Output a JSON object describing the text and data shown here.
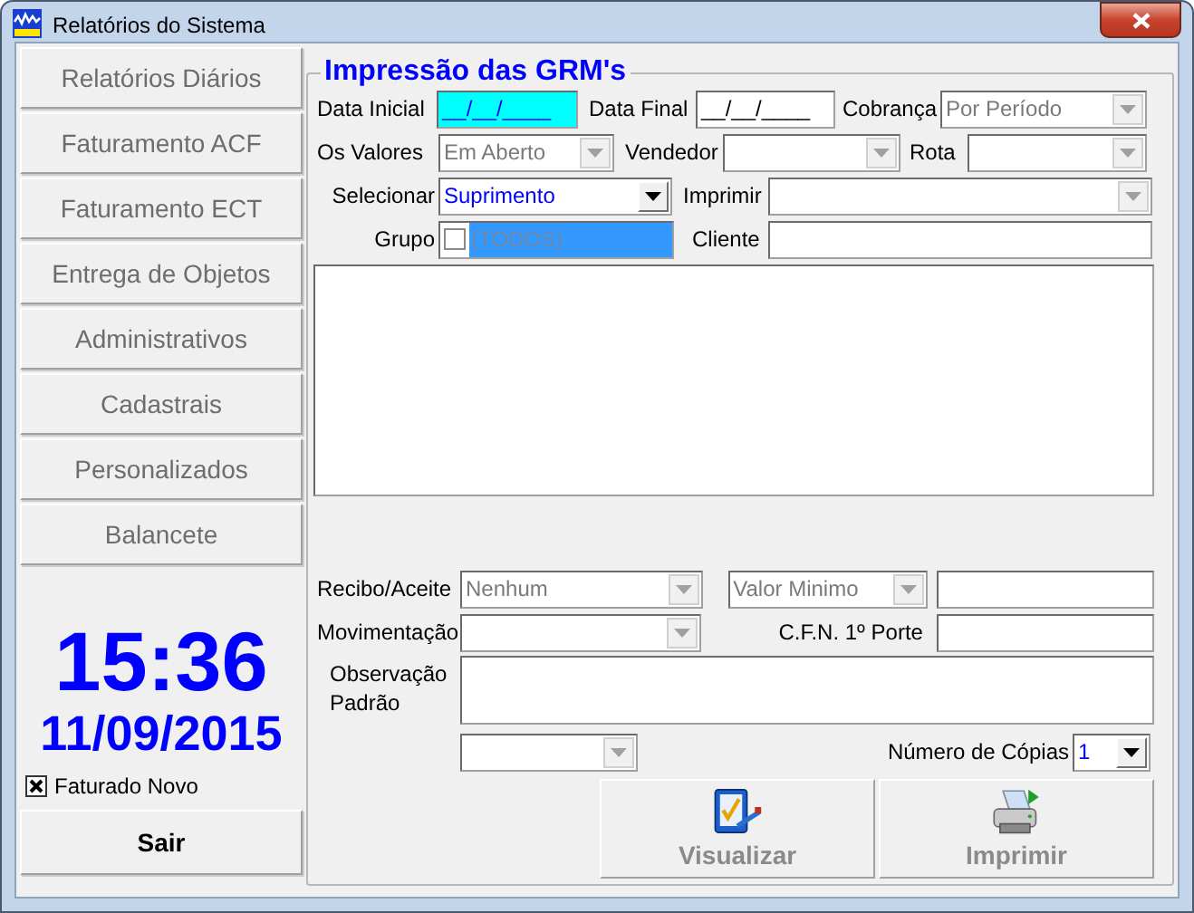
{
  "window": {
    "title": "Relatórios do Sistema"
  },
  "menu": [
    {
      "label": "Relatórios Diários",
      "disabled": true
    },
    {
      "label": "Faturamento ACF",
      "disabled": true
    },
    {
      "label": "Faturamento ECT",
      "disabled": true
    },
    {
      "label": "Entrega de Objetos",
      "disabled": true
    },
    {
      "label": "Administrativos",
      "disabled": true
    },
    {
      "label": "Cadastrais",
      "disabled": true
    },
    {
      "label": "Personalizados",
      "disabled": true
    },
    {
      "label": "Balancete",
      "disabled": true
    }
  ],
  "clock": {
    "time": "15:36",
    "date": "11/09/2015"
  },
  "faturado_novo": {
    "label": "Faturado Novo",
    "checked": true
  },
  "exit_button": {
    "label": "Sair",
    "disabled": false
  },
  "form": {
    "title": "Impressão das GRM's",
    "data_inicial": {
      "label": "Data Inicial",
      "value": "__/__/____",
      "focused": true
    },
    "data_final": {
      "label": "Data Final",
      "value": "__/__/____",
      "focused": false
    },
    "cobranca": {
      "label": "Cobrança",
      "value": "Por Período",
      "disabled": true
    },
    "os_valores": {
      "label": "Os Valores",
      "value": "Em Aberto",
      "disabled": true
    },
    "vendedor": {
      "label": "Vendedor",
      "disabled": true
    },
    "rota": {
      "label": "Rota",
      "disabled": true
    },
    "selecionar": {
      "label": "Selecionar",
      "value": "Suprimento",
      "disabled": false
    },
    "imprimir": {
      "label": "Imprimir",
      "disabled": true
    },
    "grupo": {
      "label": "Grupo",
      "option": "(TODOS)",
      "checked": false,
      "selected": true
    },
    "cliente": {
      "label": "Cliente"
    },
    "recibo_aceite": {
      "label": "Recibo/Aceite",
      "value": "Nenhum",
      "disabled": true
    },
    "valor_minimo": {
      "value": "Valor Minimo",
      "disabled": true
    },
    "movimentacao": {
      "label": "Movimentação",
      "disabled": true
    },
    "cfn": {
      "label": "C.F.N. 1º Porte"
    },
    "observacao": {
      "label": "Observação Padrão"
    },
    "extra_combo": {
      "disabled": true
    },
    "copias": {
      "label": "Número de Cópias",
      "value": "1",
      "disabled": false
    }
  },
  "actions": [
    {
      "label": "Visualizar",
      "kind": "preview",
      "disabled": true
    },
    {
      "label": "Imprimir",
      "kind": "print",
      "disabled": true
    }
  ]
}
